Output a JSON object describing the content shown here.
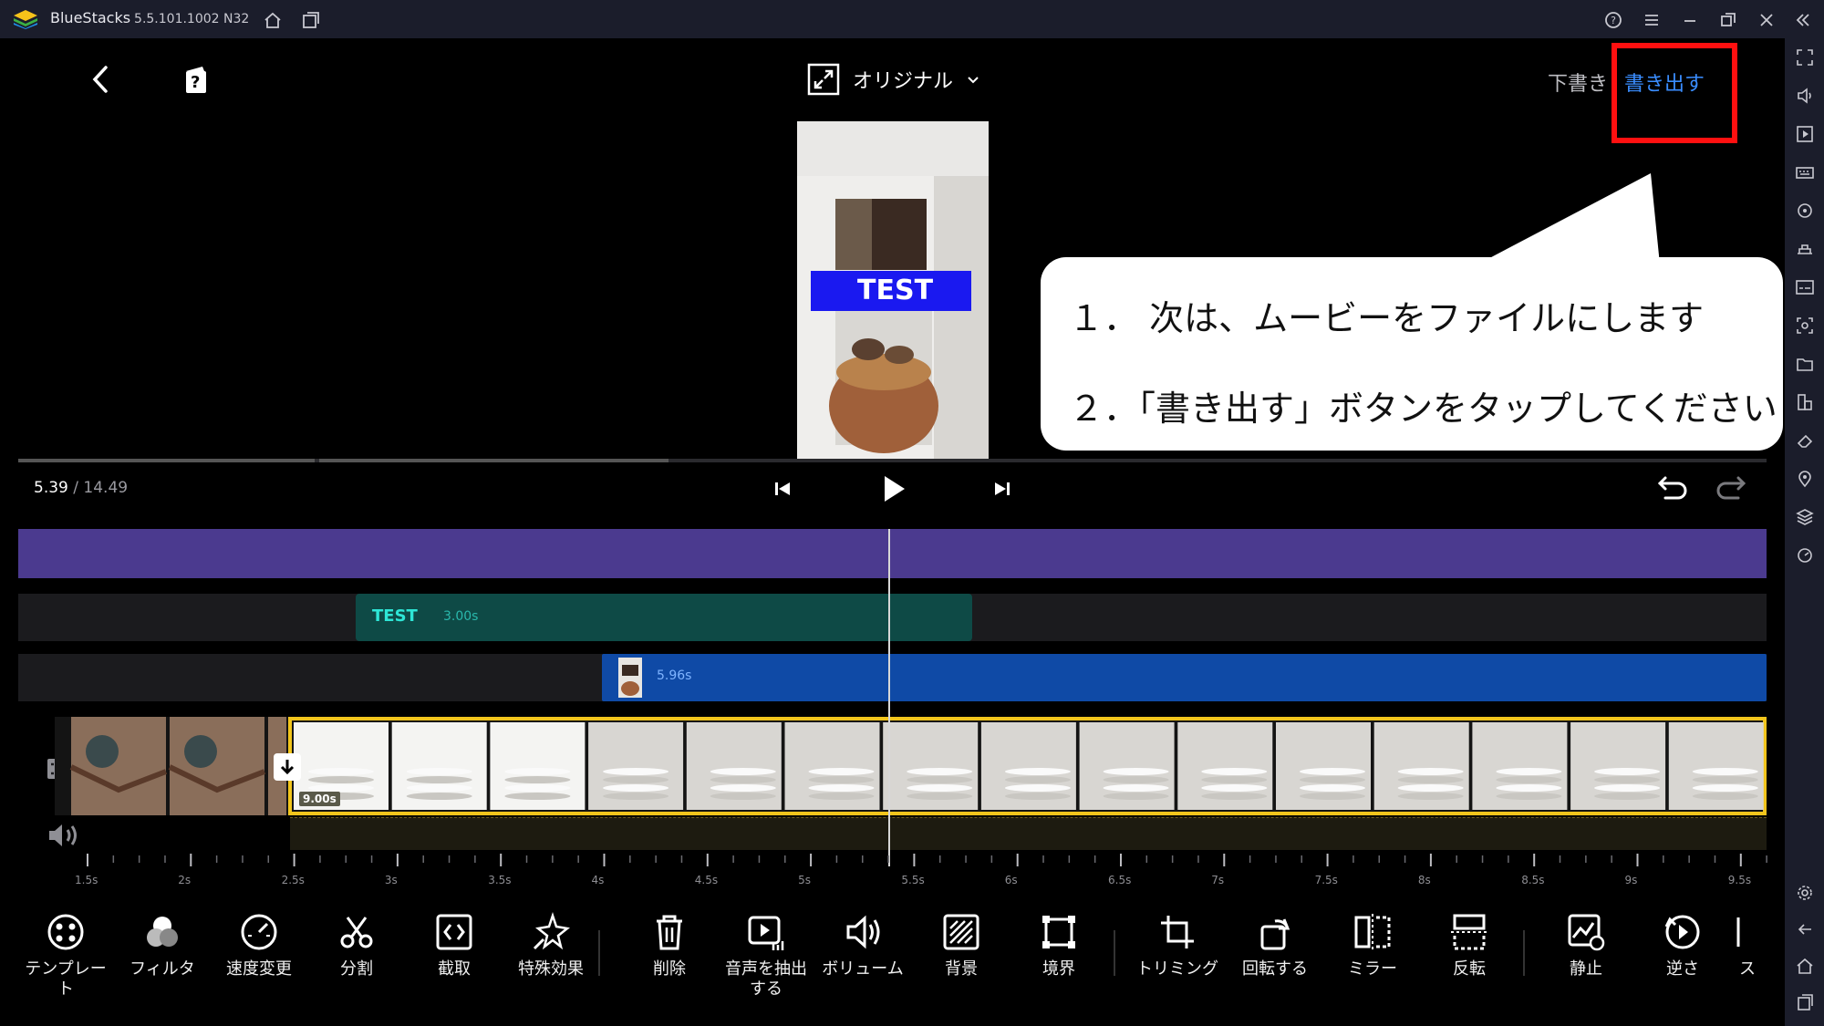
{
  "window": {
    "title": "BlueStacks",
    "version": "5.5.101.1002",
    "build": "N32"
  },
  "topbar": {
    "ratio_label": "オリジナル",
    "draft_label": "下書き",
    "export_label": "書き出す",
    "question_badge": "?"
  },
  "preview": {
    "overlay_text": "TEST"
  },
  "callout": {
    "line1": "１．  次は、ムービーをファイルにします",
    "line2": "２．「書き出す」ボタンをタップしてください"
  },
  "playback": {
    "current_time": "5.39",
    "separator": " / ",
    "total_time": "14.49"
  },
  "timeline": {
    "text_clip_label": "TEST",
    "text_clip_duration": "3.00s",
    "image_clip_duration": "5.96s",
    "video_clip_duration": "9.00s",
    "ruler_ticks": [
      "1.5s",
      "2s",
      "2.5s",
      "3s",
      "3.5s",
      "4s",
      "4.5s",
      "5s",
      "5.5s",
      "6s",
      "6.5s",
      "7s",
      "7.5s",
      "8s",
      "8.5s",
      "9s",
      "9.5s"
    ]
  },
  "toolbar": [
    {
      "label": "テンプレー\nト",
      "icon": "template-icon"
    },
    {
      "label": "フィルタ",
      "icon": "filter-icon"
    },
    {
      "label": "速度変更",
      "icon": "speed-icon"
    },
    {
      "label": "分割",
      "icon": "scissors-icon"
    },
    {
      "label": "截取",
      "icon": "extract-icon"
    },
    {
      "label": "特殊効果",
      "icon": "sparkle-icon"
    },
    {
      "label": "削除",
      "icon": "trash-icon"
    },
    {
      "label": "音声を抽出\nする",
      "icon": "audio-extract-icon"
    },
    {
      "label": "ボリューム",
      "icon": "volume-icon"
    },
    {
      "label": "背景",
      "icon": "background-icon"
    },
    {
      "label": "境界",
      "icon": "border-icon"
    },
    {
      "label": "トリミング",
      "icon": "crop-icon"
    },
    {
      "label": "回転する",
      "icon": "rotate-icon"
    },
    {
      "label": "ミラー",
      "icon": "mirror-icon"
    },
    {
      "label": "反転",
      "icon": "flip-icon"
    },
    {
      "label": "静止",
      "icon": "freeze-icon"
    },
    {
      "label": "逆さ",
      "icon": "reverse-icon"
    },
    {
      "label": "ス",
      "icon": "more-icon"
    }
  ],
  "colors": {
    "accent": "#3a8dff",
    "highlight": "#ff1010",
    "music_track": "#4b3a8f",
    "text_clip": "#0e4a46",
    "image_clip": "#0f4aa6",
    "video_border": "#f2c51c",
    "test_banner": "#1a19f0"
  }
}
